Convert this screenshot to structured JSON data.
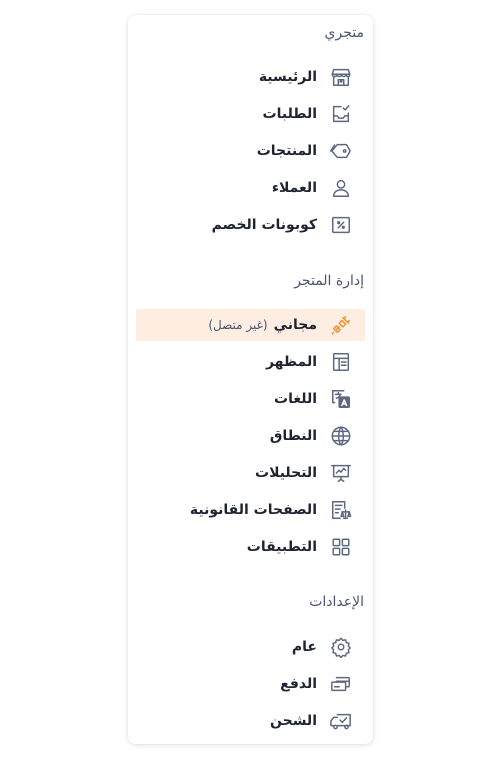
{
  "sections": [
    {
      "title": "متجري",
      "items": [
        {
          "label": "الرئيسية",
          "icon": "store-icon"
        },
        {
          "label": "الطلبات",
          "icon": "inbox-check-icon"
        },
        {
          "label": "المنتجات",
          "icon": "tags-icon"
        },
        {
          "label": "العملاء",
          "icon": "user-icon"
        },
        {
          "label": "كوبونات الخصم",
          "icon": "percent-coupon-icon"
        }
      ]
    },
    {
      "title": "إدارة المتجر",
      "items": [
        {
          "label": "مجاني",
          "tag": "(غير متصل)",
          "icon": "plug-disconnected-icon",
          "active": true
        },
        {
          "label": "المظهر",
          "icon": "layout-icon"
        },
        {
          "label": "اللغات",
          "icon": "translate-icon"
        },
        {
          "label": "النطاق",
          "icon": "globe-icon"
        },
        {
          "label": "التحليلات",
          "icon": "presentation-chart-icon"
        },
        {
          "label": "الصفحات القانونية",
          "icon": "legal-scale-icon"
        },
        {
          "label": "التطبيقات",
          "icon": "grid-apps-icon"
        }
      ]
    },
    {
      "title": "الإعدادات",
      "items": [
        {
          "label": "عام",
          "icon": "gear-icon"
        },
        {
          "label": "الدفع",
          "icon": "payment-cards-icon"
        },
        {
          "label": "الشحن",
          "icon": "delivery-truck-icon"
        }
      ]
    }
  ],
  "colors": {
    "active_background": "#fdeee1",
    "active_icon": "#f09030",
    "icon": "#5d6780",
    "section_title": "#4a5470",
    "label": "#1f2430"
  }
}
